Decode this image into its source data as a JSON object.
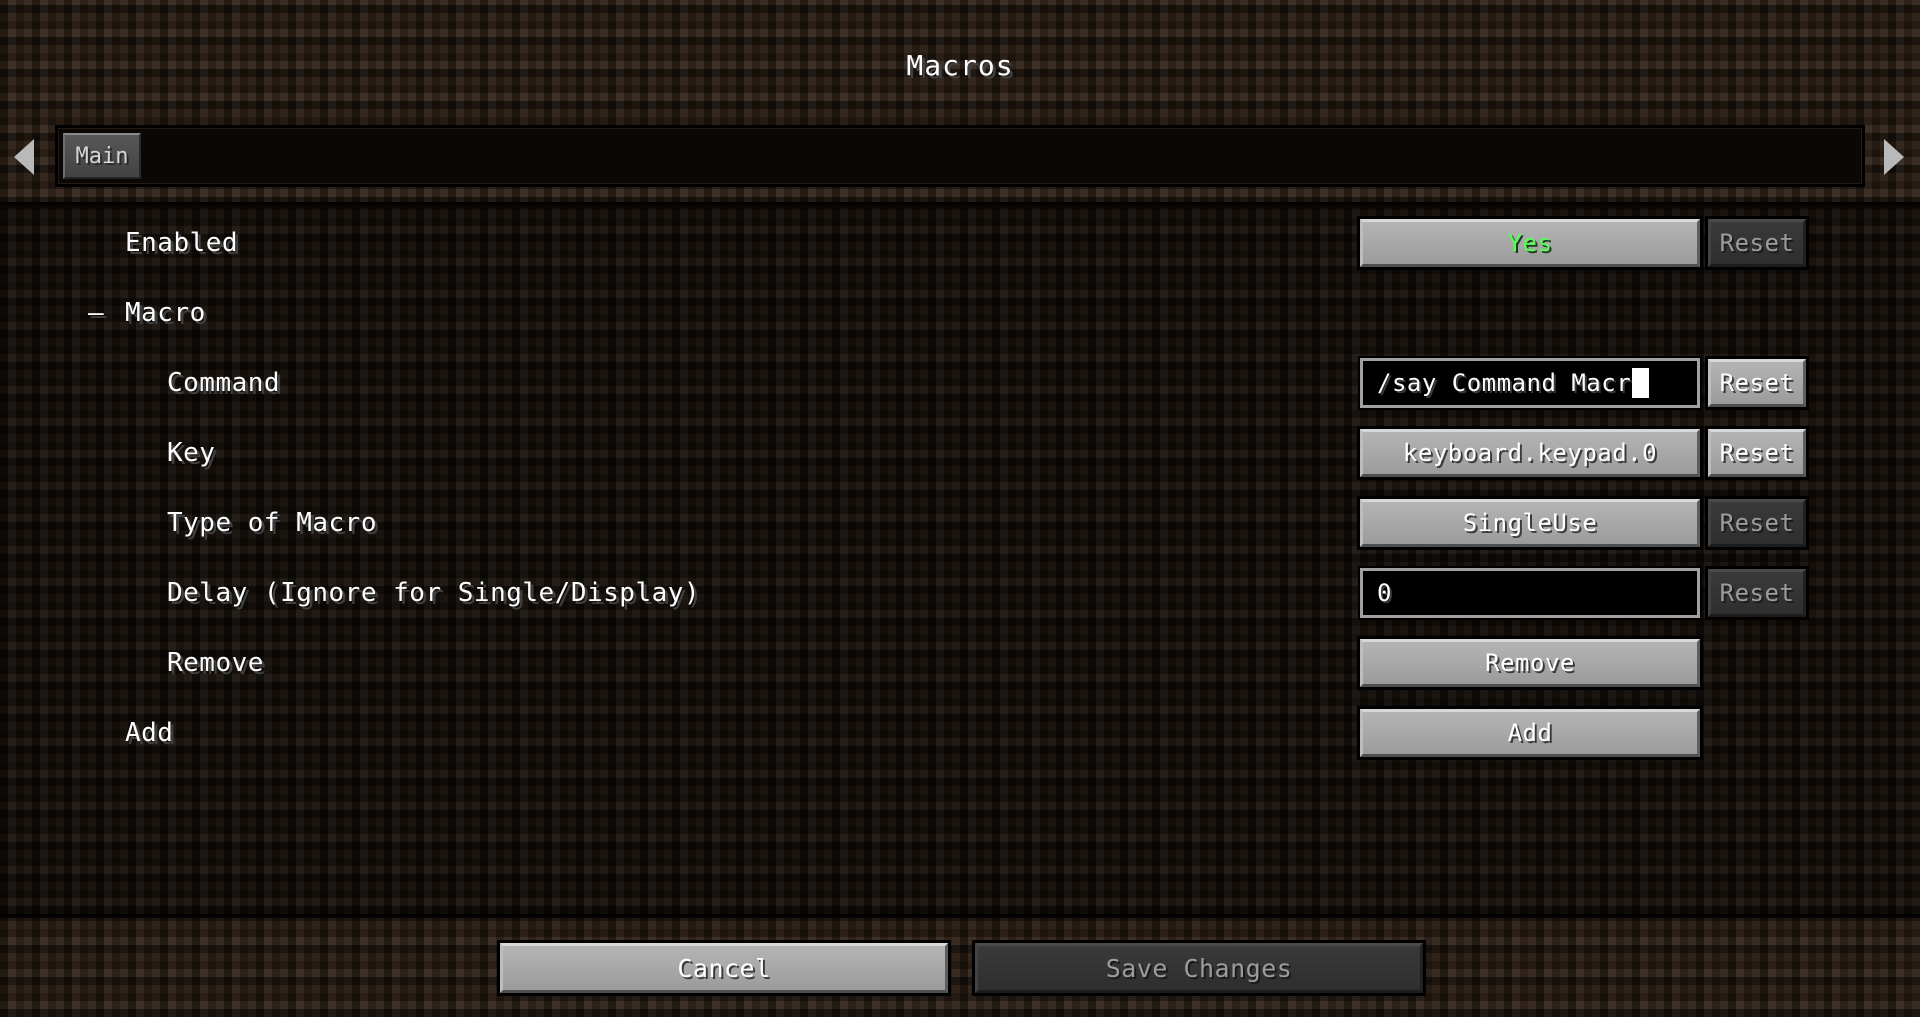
{
  "window": {
    "title": "Macros"
  },
  "tabs": {
    "prev_arrow_icon": "chevron-left-icon",
    "next_arrow_icon": "chevron-right-icon",
    "items": [
      {
        "label": "Main",
        "selected": true
      }
    ]
  },
  "rows": [
    {
      "label": "Enabled",
      "indent": 0,
      "kind": "toggle",
      "value": "Yes",
      "value_color": "#55ff55",
      "reset_label": "Reset",
      "reset_enabled": false
    },
    {
      "label": "Macro",
      "indent": 0,
      "kind": "category",
      "marker": "—"
    },
    {
      "label": "Command",
      "indent": 1,
      "kind": "textfield",
      "value": "/say Command Macr",
      "placeholder": "",
      "caret": true,
      "reset_label": "Reset",
      "reset_enabled": true
    },
    {
      "label": "Key",
      "indent": 1,
      "kind": "button",
      "value": "keyboard.keypad.0",
      "reset_label": "Reset",
      "reset_enabled": true
    },
    {
      "label": "Type of Macro",
      "indent": 1,
      "kind": "button",
      "value": "SingleUse",
      "reset_label": "Reset",
      "reset_enabled": false
    },
    {
      "label": "Delay (Ignore for Single/Display)",
      "indent": 1,
      "kind": "textfield",
      "value": "0",
      "placeholder": "",
      "caret": false,
      "reset_label": "Reset",
      "reset_enabled": false
    },
    {
      "label": "Remove",
      "indent": 1,
      "kind": "action",
      "value": "Remove"
    },
    {
      "label": "Add",
      "indent": 0,
      "kind": "action",
      "value": "Add"
    }
  ],
  "footer": {
    "cancel_label": "Cancel",
    "cancel_enabled": true,
    "save_label": "Save Changes",
    "save_enabled": false
  },
  "colors": {
    "background": "#2b1e13",
    "content_background": "#17100a",
    "accent_green": "#55ff55",
    "button_face": "#a8a8a8",
    "button_disabled": "#343434",
    "text": "#ffffff",
    "text_disabled": "#9c9c9c"
  }
}
